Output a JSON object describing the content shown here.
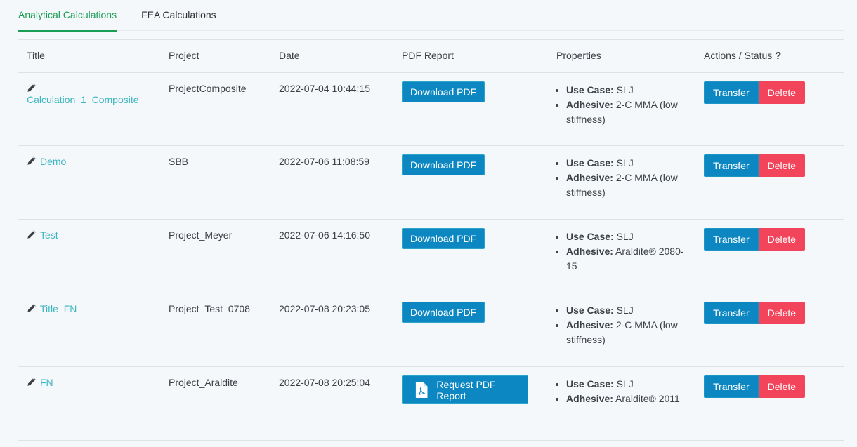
{
  "tabs": [
    {
      "label": "Analytical Calculations",
      "active": true
    },
    {
      "label": "FEA Calculations",
      "active": false
    }
  ],
  "table": {
    "headers": [
      "Title",
      "Project",
      "Date",
      "PDF Report",
      "Properties",
      "Actions / Status"
    ],
    "help_icon": "?",
    "rows": [
      {
        "title": "Calculation_1_Composite",
        "project": "ProjectComposite",
        "date": "2022-07-04 10:44:15",
        "pdf_button": "Download PDF",
        "use_case_label": "Use Case:",
        "use_case": "SLJ",
        "adhesive_label": "Adhesive:",
        "adhesive": "2-C MMA (low stiffness)",
        "transfer": "Transfer",
        "delete": "Delete"
      },
      {
        "title": "Demo",
        "project": "SBB",
        "date": "2022-07-06 11:08:59",
        "pdf_button": "Download PDF",
        "use_case_label": "Use Case:",
        "use_case": "SLJ",
        "adhesive_label": "Adhesive:",
        "adhesive": "2-C MMA (low stiffness)",
        "transfer": "Transfer",
        "delete": "Delete"
      },
      {
        "title": "Test",
        "project": "Project_Meyer",
        "date": "2022-07-06 14:16:50",
        "pdf_button": "Download PDF",
        "use_case_label": "Use Case:",
        "use_case": "SLJ",
        "adhesive_label": "Adhesive:",
        "adhesive": "Araldite® 2080-15",
        "transfer": "Transfer",
        "delete": "Delete"
      },
      {
        "title": "Title_FN",
        "project": "Project_Test_0708",
        "date": "2022-07-08 20:23:05",
        "pdf_button": "Download PDF",
        "use_case_label": "Use Case:",
        "use_case": "SLJ",
        "adhesive_label": "Adhesive:",
        "adhesive": "2-C MMA (low stiffness)",
        "transfer": "Transfer",
        "delete": "Delete"
      },
      {
        "title": "FN",
        "project": "Project_Araldite",
        "date": "2022-07-08 20:25:04",
        "pdf_button": "Request PDF Report",
        "use_case_label": "Use Case:",
        "use_case": "SLJ",
        "adhesive_label": "Adhesive:",
        "adhesive": "Araldite® 2011",
        "transfer": "Transfer",
        "delete": "Delete"
      }
    ]
  }
}
